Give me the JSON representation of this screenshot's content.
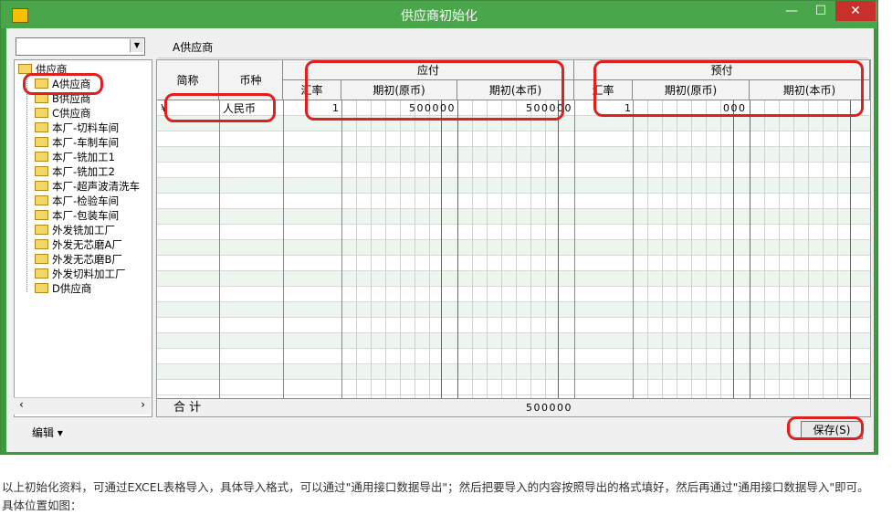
{
  "window": {
    "title": "供应商初始化"
  },
  "window_buttons": {
    "minimize": "—",
    "maximize": "☐",
    "close": "✕"
  },
  "combo": {
    "value": ""
  },
  "tree": {
    "root": "供应商",
    "items": [
      "A供应商",
      "B供应商",
      "C供应商",
      "本厂-切料车间",
      "本厂-车制车间",
      "本厂-铣加工1",
      "本厂-铣加工2",
      "本厂-超声波清洗车",
      "本厂-检验车间",
      "本厂-包装车间",
      "外发铣加工厂",
      "外发无芯磨A厂",
      "外发无芯磨B厂",
      "外发切料加工厂",
      "D供应商"
    ]
  },
  "scroll": {
    "left": "‹",
    "right": "›"
  },
  "selected_supplier": "A供应商",
  "grid": {
    "headers": {
      "abbr": "简称",
      "currency": "币种",
      "payable": "应付",
      "prepaid": "预付",
      "rate": "汇率",
      "opening_orig": "期初(原币)",
      "opening_local": "期初(本币)"
    },
    "row1": {
      "abbr": "¥",
      "currency": "人民币",
      "pay_rate": "1",
      "pay_orig": "500000",
      "pay_local": "500000",
      "pre_rate": "1",
      "pre_orig": "000"
    },
    "totals": {
      "label": "合  计",
      "pay_local": "500000"
    }
  },
  "buttons": {
    "edit": "编辑 ▾",
    "save": "保存(S)"
  },
  "caption": "以上初始化资料，可通过EXCEL表格导入，具体导入格式，可以通过\"通用接口数据导出\"；然后把要导入的内容按照导出的格式填好，然后再通过\"通用接口数据导入\"即可。具体位置如图："
}
